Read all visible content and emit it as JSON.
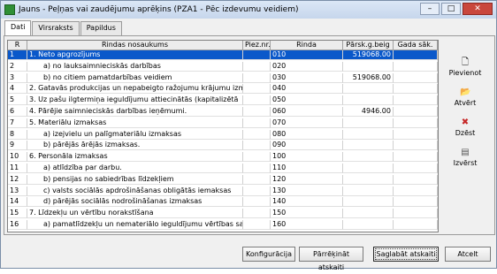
{
  "window": {
    "title": "Jauns - Peļņas vai zaudējumu aprēķins (PZA1 - Pēc izdevumu veidiem)",
    "minimize": "–",
    "maximize": "□",
    "close": "✕"
  },
  "tabs": [
    {
      "label": "Dati",
      "active": true
    },
    {
      "label": "Virsraksts",
      "active": false
    },
    {
      "label": "Papildus",
      "active": false
    }
  ],
  "grid": {
    "headers": {
      "r": "R",
      "name": "Rindas nosaukums",
      "piez": "Piez.nr.",
      "rinda": "Rinda",
      "gbeig": "Pārsk.g.beig",
      "gsak": "Gada sāk."
    },
    "rows": [
      {
        "r": "1",
        "name": "1. Neto apgrozījums",
        "piez": "",
        "rinda": "010",
        "gbeig": "519068.00",
        "gsak": "",
        "indent": false,
        "selected": true
      },
      {
        "r": "2",
        "name": "a) no lauksaimnieciskās darbības",
        "piez": "",
        "rinda": "020",
        "gbeig": "",
        "gsak": "",
        "indent": true,
        "selected": false
      },
      {
        "r": "3",
        "name": "b) no citiem pamatdarbības veidiem",
        "piez": "",
        "rinda": "030",
        "gbeig": "519068.00",
        "gsak": "",
        "indent": true,
        "selected": false
      },
      {
        "r": "4",
        "name": "2. Gatavās produkcijas un nepabeigto ražojumu krājumu izm",
        "piez": "",
        "rinda": "040",
        "gbeig": "",
        "gsak": "",
        "indent": false,
        "selected": false
      },
      {
        "r": "5",
        "name": "3. Uz pašu ilgtermiņa ieguldījumu attiecinātās (kapitalizētā",
        "piez": "",
        "rinda": "050",
        "gbeig": "",
        "gsak": "",
        "indent": false,
        "selected": false
      },
      {
        "r": "6",
        "name": "4. Pārējie saimnieciskās darbības ieņēmumi.",
        "piez": "",
        "rinda": "060",
        "gbeig": "4946.00",
        "gsak": "",
        "indent": false,
        "selected": false
      },
      {
        "r": "7",
        "name": "5. Materiālu izmaksas",
        "piez": "",
        "rinda": "070",
        "gbeig": "",
        "gsak": "",
        "indent": false,
        "selected": false
      },
      {
        "r": "8",
        "name": "a) izejvielu un palīgmateriālu izmaksas",
        "piez": "",
        "rinda": "080",
        "gbeig": "",
        "gsak": "",
        "indent": true,
        "selected": false
      },
      {
        "r": "9",
        "name": "b) pārējās ārējās izmaksas.",
        "piez": "",
        "rinda": "090",
        "gbeig": "",
        "gsak": "",
        "indent": true,
        "selected": false
      },
      {
        "r": "10",
        "name": "6. Personāla izmaksas",
        "piez": "",
        "rinda": "100",
        "gbeig": "",
        "gsak": "",
        "indent": false,
        "selected": false
      },
      {
        "r": "11",
        "name": "a) atlīdzība par darbu.",
        "piez": "",
        "rinda": "110",
        "gbeig": "",
        "gsak": "",
        "indent": true,
        "selected": false
      },
      {
        "r": "12",
        "name": "b) pensijas no sabiedrības līdzekļiem",
        "piez": "",
        "rinda": "120",
        "gbeig": "",
        "gsak": "",
        "indent": true,
        "selected": false
      },
      {
        "r": "13",
        "name": "c) valsts sociālās apdrošināšanas obligātās iemaksas",
        "piez": "",
        "rinda": "130",
        "gbeig": "",
        "gsak": "",
        "indent": true,
        "selected": false
      },
      {
        "r": "14",
        "name": "d) pārējās sociālās nodrošināšanas izmaksas",
        "piez": "",
        "rinda": "140",
        "gbeig": "",
        "gsak": "",
        "indent": true,
        "selected": false
      },
      {
        "r": "15",
        "name": "7. Līdzekļu un vērtību norakstīšana",
        "piez": "",
        "rinda": "150",
        "gbeig": "",
        "gsak": "",
        "indent": false,
        "selected": false
      },
      {
        "r": "16",
        "name": "a) pamatlīdzekļu un nemateriālo ieguldījumu vērtības sama",
        "piez": "",
        "rinda": "160",
        "gbeig": "",
        "gsak": "",
        "indent": true,
        "selected": false
      }
    ]
  },
  "side_buttons": [
    {
      "label": "Pievienot",
      "icon": "new-document-icon",
      "glyph": "🗋"
    },
    {
      "label": "Atvērt",
      "icon": "open-folder-icon",
      "glyph": "📂"
    },
    {
      "label": "Dzēst",
      "icon": "delete-x-icon",
      "glyph": "✖"
    },
    {
      "label": "Izvērst",
      "icon": "list-document-icon",
      "glyph": "▤"
    }
  ],
  "bottom_buttons": {
    "config": "Konfigurācija",
    "recalc": "Pārrēķināt atskaiti",
    "save": "Saglabāt atskaiti",
    "cancel": "Atcelt"
  },
  "colors": {
    "selection": "#0a58ca",
    "delete_icon": "#c62828"
  }
}
